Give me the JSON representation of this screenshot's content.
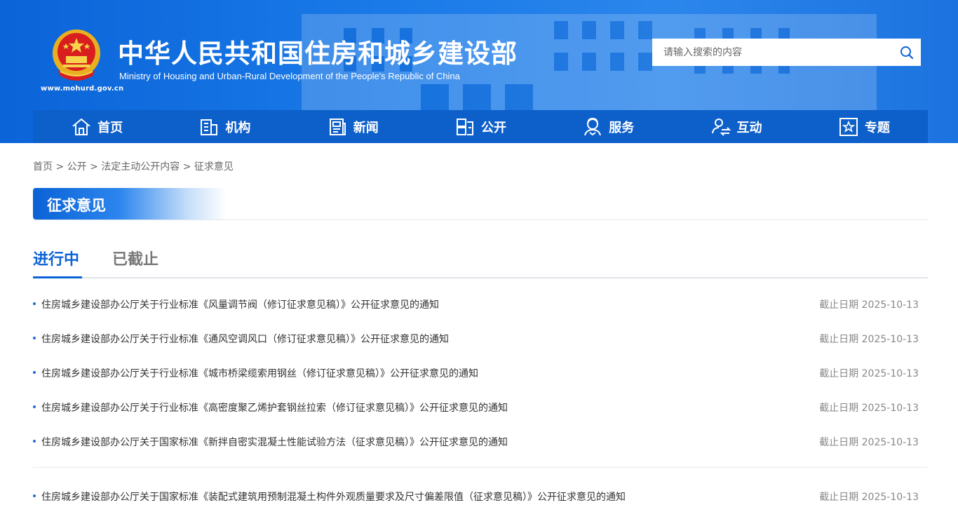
{
  "header": {
    "title_cn": "中华人民共和国住房和城乡建设部",
    "title_en": "Ministry of Housing and Urban-Rural Development of the People's Republic of China",
    "site_url": "www.mohurd.gov.cn",
    "emblem_icon": "national-emblem-icon"
  },
  "search": {
    "placeholder": "请输入搜索的内容",
    "icon": "search-icon"
  },
  "nav": {
    "items": [
      {
        "label": "首页",
        "icon": "home-icon"
      },
      {
        "label": "机构",
        "icon": "building-icon"
      },
      {
        "label": "新闻",
        "icon": "news-icon"
      },
      {
        "label": "公开",
        "icon": "folder-icon"
      },
      {
        "label": "服务",
        "icon": "service-icon"
      },
      {
        "label": "互动",
        "icon": "interaction-icon"
      },
      {
        "label": "专题",
        "icon": "star-frame-icon"
      }
    ]
  },
  "breadcrumb": {
    "items": [
      "首页",
      "公开",
      "法定主动公开内容",
      "征求意见"
    ],
    "separator": ">"
  },
  "section": {
    "title": "征求意见"
  },
  "tabs": {
    "active": "进行中",
    "inactive": "已截止"
  },
  "list": {
    "items": [
      {
        "title": "住房城乡建设部办公厅关于行业标准《风量调节阀（修订征求意见稿）》公开征求意见的通知",
        "date": "截止日期 2025-10-13"
      },
      {
        "title": "住房城乡建设部办公厅关于行业标准《通风空调风口（修订征求意见稿）》公开征求意见的通知",
        "date": "截止日期 2025-10-13"
      },
      {
        "title": "住房城乡建设部办公厅关于行业标准《城市桥梁缆索用钢丝（修订征求意见稿）》公开征求意见的通知",
        "date": "截止日期 2025-10-13"
      },
      {
        "title": "住房城乡建设部办公厅关于行业标准《高密度聚乙烯护套钢丝拉索（修订征求意见稿）》公开征求意见的通知",
        "date": "截止日期 2025-10-13"
      },
      {
        "title": "住房城乡建设部办公厅关于国家标准《新拌自密实混凝土性能试验方法（征求意见稿）》公开征求意见的通知",
        "date": "截止日期 2025-10-13"
      },
      {
        "title": "住房城乡建设部办公厅关于国家标准《装配式建筑用预制混凝土构件外观质量要求及尺寸偏差限值（征求意见稿）》公开征求意见的通知",
        "date": "截止日期 2025-10-13"
      }
    ]
  },
  "colors": {
    "brand_blue": "#0d63d6",
    "nav_blue": "#0d5fc9",
    "header_blue": "#1a7ae8"
  }
}
